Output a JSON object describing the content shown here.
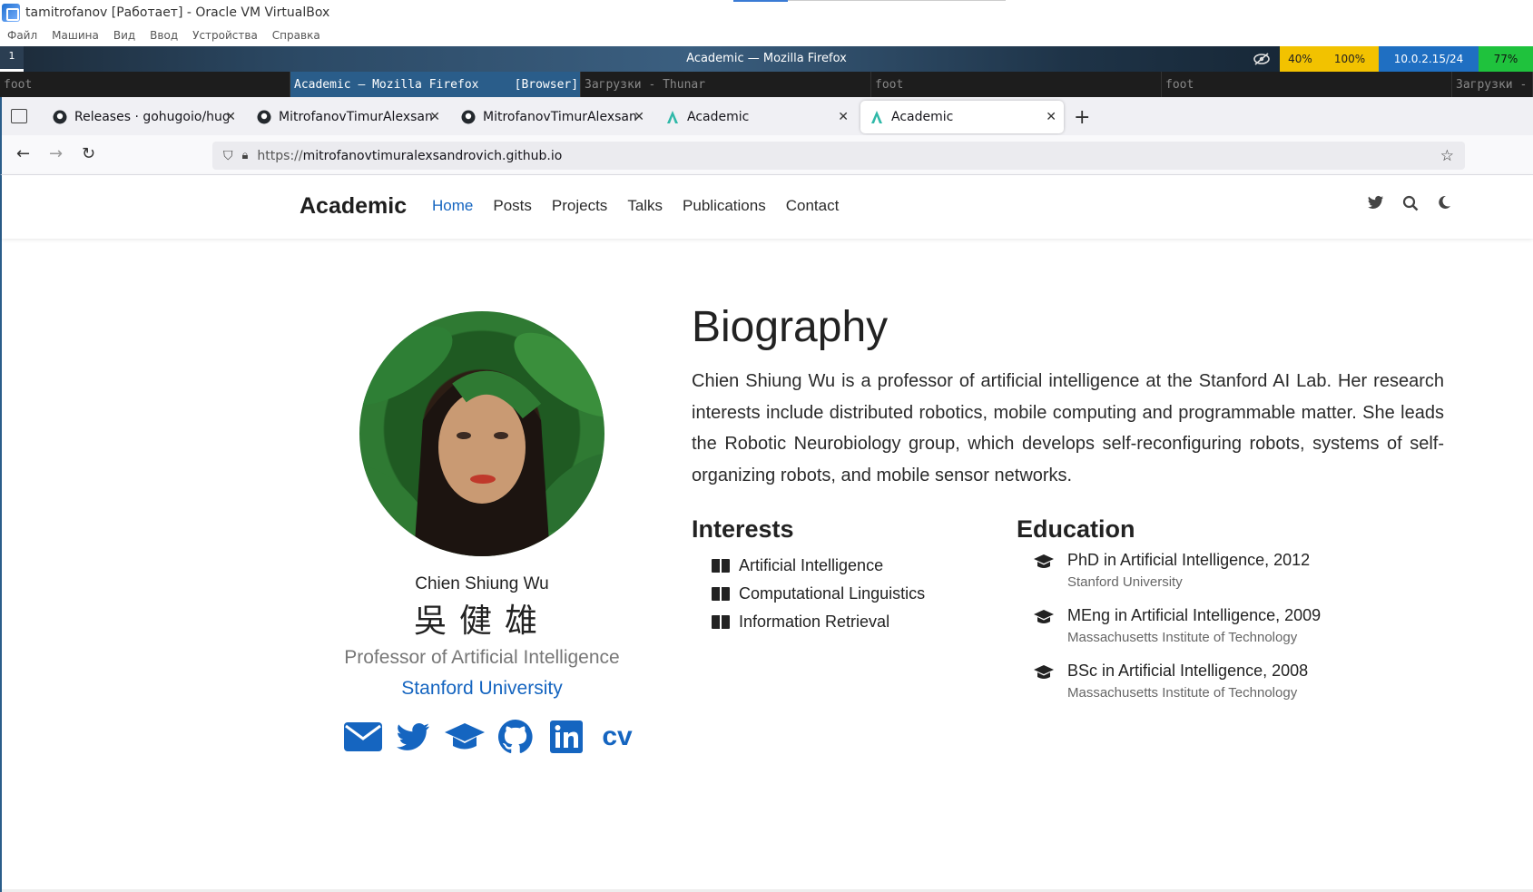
{
  "vbox": {
    "title": "tamitrofanov [Работает] - Oracle VM VirtualBox",
    "menu": [
      "Файл",
      "Машина",
      "Вид",
      "Ввод",
      "Устройства",
      "Справка"
    ]
  },
  "swaybar": {
    "workspace": "1",
    "window_title": "Academic — Mozilla Firefox",
    "status": {
      "cpu": "40%",
      "volume": "100%",
      "ip": "10.0.2.15/24",
      "battery": "77%"
    }
  },
  "tiles": [
    {
      "label": "foot"
    },
    {
      "label": "Academic — Mozilla Firefox     [Browser]"
    },
    {
      "label": "Загрузки - Thunar"
    },
    {
      "label": "foot"
    },
    {
      "label": "foot"
    },
    {
      "label": "Загрузки -"
    }
  ],
  "browser": {
    "tabs": [
      {
        "label": "Releases · gohugoio/hugo"
      },
      {
        "label": "MitrofanovTimurAlexsand"
      },
      {
        "label": "MitrofanovTimurAlexsand"
      },
      {
        "label": "Academic"
      },
      {
        "label": "Academic"
      }
    ],
    "url_prefix": "https://",
    "url_host": "mitrofanovtimuralexsandrovich.github.io"
  },
  "site": {
    "brand": "Academic",
    "nav": [
      "Home",
      "Posts",
      "Projects",
      "Talks",
      "Publications",
      "Contact"
    ],
    "profile": {
      "name": "Chien Shiung Wu",
      "name_zh": "吳健雄",
      "role": "Professor of Artificial Intelligence",
      "organization": "Stanford University",
      "cv": "cv"
    },
    "biography": {
      "heading": "Biography",
      "text": "Chien Shiung Wu is a professor of artificial intelligence at the Stanford AI Lab. Her research interests include distributed robotics, mobile computing and programmable matter. She leads the Robotic Neurobiology group, which develops self-reconfiguring robots, systems of self-organizing robots, and mobile sensor networks."
    },
    "interests": {
      "heading": "Interests",
      "items": [
        "Artificial Intelligence",
        "Computational Linguistics",
        "Information Retrieval"
      ]
    },
    "education": {
      "heading": "Education",
      "items": [
        {
          "degree": "PhD in Artificial Intelligence, 2012",
          "institution": "Stanford University"
        },
        {
          "degree": "MEng in Artificial Intelligence, 2009",
          "institution": "Massachusetts Institute of Technology"
        },
        {
          "degree": "BSc in Artificial Intelligence, 2008",
          "institution": "Massachusetts Institute of Technology"
        }
      ]
    }
  },
  "colors": {
    "accent": "#1565c0",
    "status_yellow": "#f2c200",
    "status_blue": "#1f6fc2",
    "status_green": "#1fc23d"
  }
}
